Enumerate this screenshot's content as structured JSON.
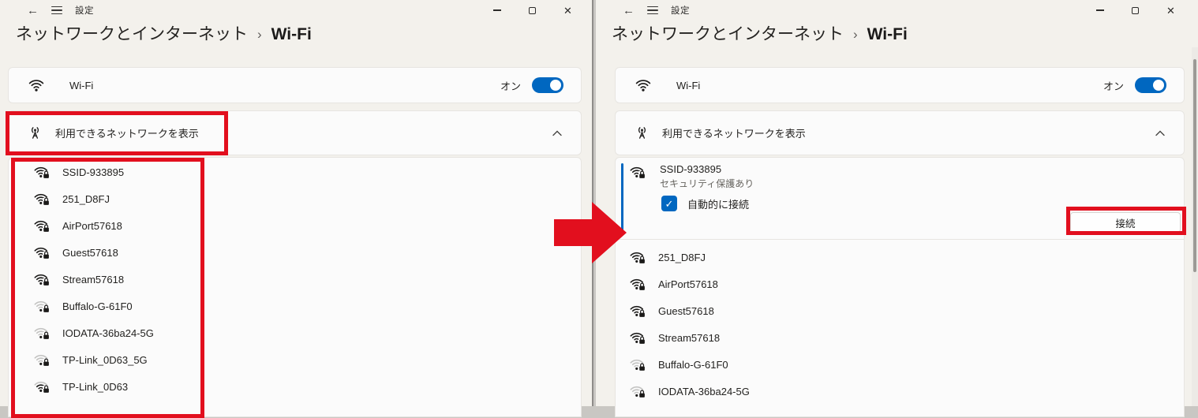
{
  "colors": {
    "accent": "#0067c0",
    "annotation": "#e20f1e",
    "card_bg": "#fbfbfb",
    "page_bg": "#f3f1ec"
  },
  "left_window": {
    "titlebar": {
      "app_title": "設定"
    },
    "breadcrumb": {
      "parent": "ネットワークとインターネット",
      "separator": "›",
      "current": "Wi-Fi"
    },
    "wifi_row": {
      "label": "Wi-Fi",
      "state_label": "オン",
      "on": true
    },
    "expander": {
      "label": "利用できるネットワークを表示"
    },
    "networks": [
      {
        "name": "SSID-933895",
        "secured": true,
        "signal": 3
      },
      {
        "name": "251_D8FJ",
        "secured": true,
        "signal": 3
      },
      {
        "name": "AirPort57618",
        "secured": true,
        "signal": 3
      },
      {
        "name": "Guest57618",
        "secured": true,
        "signal": 3
      },
      {
        "name": "Stream57618",
        "secured": true,
        "signal": 3
      },
      {
        "name": "Buffalo-G-61F0",
        "secured": true,
        "signal": 1
      },
      {
        "name": "IODATA-36ba24-5G",
        "secured": true,
        "signal": 1
      },
      {
        "name": "TP-Link_0D63_5G",
        "secured": true,
        "signal": 1
      },
      {
        "name": "TP-Link_0D63",
        "secured": true,
        "signal": 2
      }
    ]
  },
  "right_window": {
    "titlebar": {
      "app_title": "設定"
    },
    "breadcrumb": {
      "parent": "ネットワークとインターネット",
      "separator": "›",
      "current": "Wi-Fi"
    },
    "wifi_row": {
      "label": "Wi-Fi",
      "state_label": "オン",
      "on": true
    },
    "expander": {
      "label": "利用できるネットワークを表示"
    },
    "selected_network": {
      "name": "SSID-933895",
      "security_label": "セキュリティ保護あり",
      "auto_connect_label": "自動的に接続",
      "auto_connect_checked": true,
      "connect_button_label": "接続",
      "secured": true,
      "signal": 3
    },
    "networks": [
      {
        "name": "251_D8FJ",
        "secured": true,
        "signal": 3
      },
      {
        "name": "AirPort57618",
        "secured": true,
        "signal": 3
      },
      {
        "name": "Guest57618",
        "secured": true,
        "signal": 3
      },
      {
        "name": "Stream57618",
        "secured": true,
        "signal": 3
      },
      {
        "name": "Buffalo-G-61F0",
        "secured": true,
        "signal": 1
      },
      {
        "name": "IODATA-36ba24-5G",
        "secured": true,
        "signal": 1
      }
    ]
  }
}
